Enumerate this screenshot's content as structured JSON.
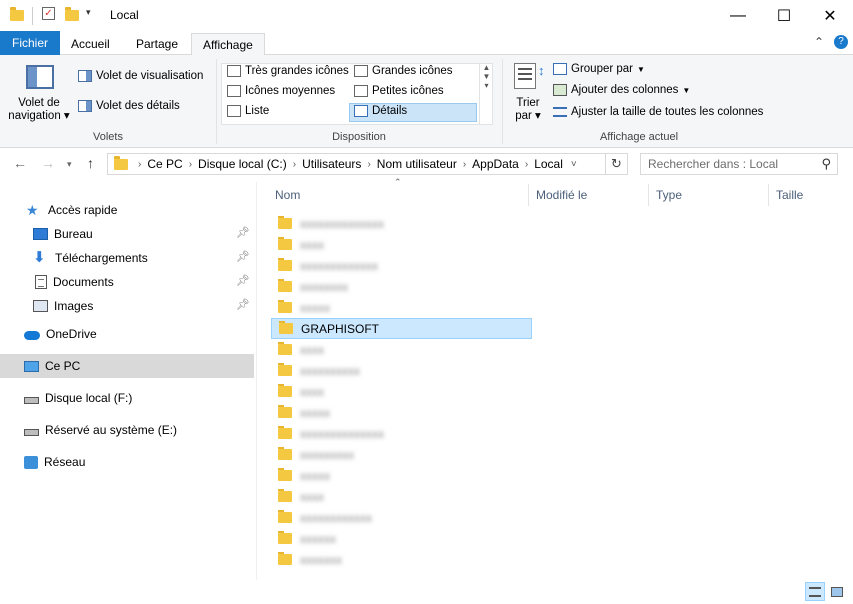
{
  "window": {
    "title": "Local",
    "minimize": "—",
    "maximize": "☐",
    "close": "✕"
  },
  "tabs": {
    "file": "Fichier",
    "home": "Accueil",
    "share": "Partage",
    "view": "Affichage",
    "collapse_icon": "chevron-up",
    "help_icon": "help"
  },
  "ribbon": {
    "panes": {
      "nav_pane": "Volet de navigation",
      "preview_pane": "Volet de visualisation",
      "details_pane": "Volet des détails",
      "group": "Volets"
    },
    "layout": {
      "items": [
        "Très grandes icônes",
        "Grandes icônes",
        "Icônes moyennes",
        "Petites icônes",
        "Liste",
        "Détails"
      ],
      "selected": "Détails",
      "group": "Disposition"
    },
    "current_view": {
      "sort_by": "Trier par",
      "group_by": "Grouper par",
      "add_columns": "Ajouter des colonnes",
      "size_columns": "Ajuster la taille de toutes les colonnes",
      "group": "Affichage actuel"
    }
  },
  "address": {
    "crumbs": [
      "Ce PC",
      "Disque local (C:)",
      "Utilisateurs",
      "Nom utilisateur",
      "AppData",
      "Local"
    ],
    "search_placeholder": "Rechercher dans : Local"
  },
  "sidebar": {
    "items": [
      {
        "label": "Accès rapide",
        "icon": "star-icon"
      },
      {
        "label": "Bureau",
        "icon": "desktop-icon",
        "pinned": true
      },
      {
        "label": "Téléchargements",
        "icon": "download-icon",
        "pinned": true
      },
      {
        "label": "Documents",
        "icon": "document-icon",
        "pinned": true
      },
      {
        "label": "Images",
        "icon": "image-icon",
        "pinned": true
      },
      {
        "label": "OneDrive",
        "icon": "cloud-icon"
      },
      {
        "label": "Ce PC",
        "icon": "pc-icon",
        "selected": true
      },
      {
        "label": "Disque local (F:)",
        "icon": "drive-icon"
      },
      {
        "label": "Réservé au système (E:)",
        "icon": "drive-icon"
      },
      {
        "label": "Réseau",
        "icon": "network-icon"
      }
    ]
  },
  "columns": {
    "name": "Nom",
    "modified": "Modifié le",
    "type": "Type",
    "size": "Taille"
  },
  "files": {
    "selected": "GRAPHISOFT",
    "blurred_count": 18
  },
  "colors": {
    "accent": "#1979ca",
    "selection": "#cce8ff",
    "folder": "#f5c842"
  }
}
